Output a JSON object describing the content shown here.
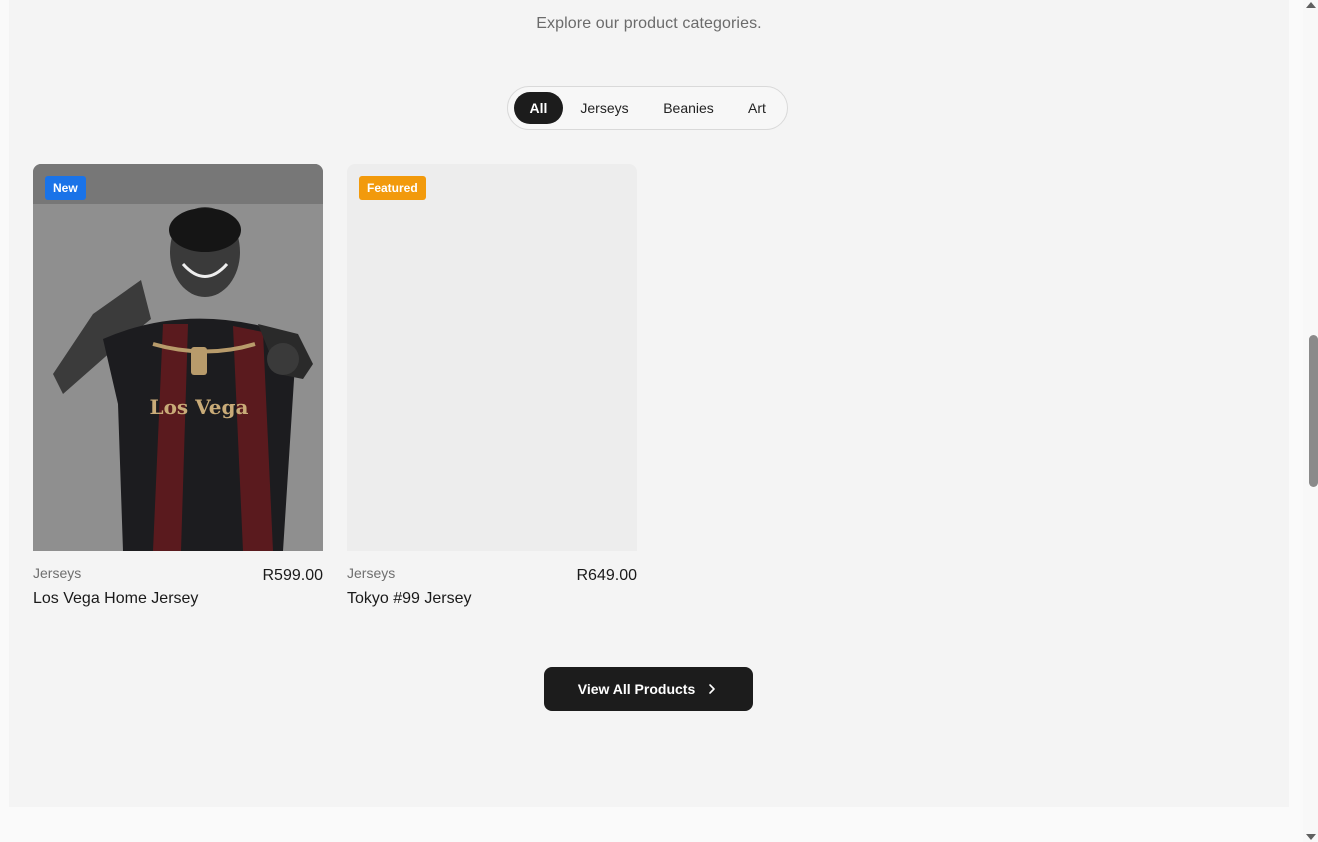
{
  "section": {
    "subtitle": "Explore our product categories."
  },
  "filters": {
    "tabs": [
      {
        "label": "All",
        "active": true
      },
      {
        "label": "Jerseys",
        "active": false
      },
      {
        "label": "Beanies",
        "active": false
      },
      {
        "label": "Art",
        "active": false
      }
    ]
  },
  "products": [
    {
      "badge": "New",
      "badge_color": "#1a73e8",
      "category": "Jerseys",
      "price": "R599.00",
      "name": "Los Vega Home Jersey",
      "jersey_print": "Los Vega"
    },
    {
      "badge": "Featured",
      "badge_color": "#f29a0c",
      "category": "Jerseys",
      "price": "R649.00",
      "name": "Tokyo #99 Jersey"
    }
  ],
  "cta": {
    "label": "View All Products",
    "icon": "chevron-right-icon"
  },
  "colors": {
    "background": "#f4f4f4",
    "dark": "#1c1c1c"
  }
}
